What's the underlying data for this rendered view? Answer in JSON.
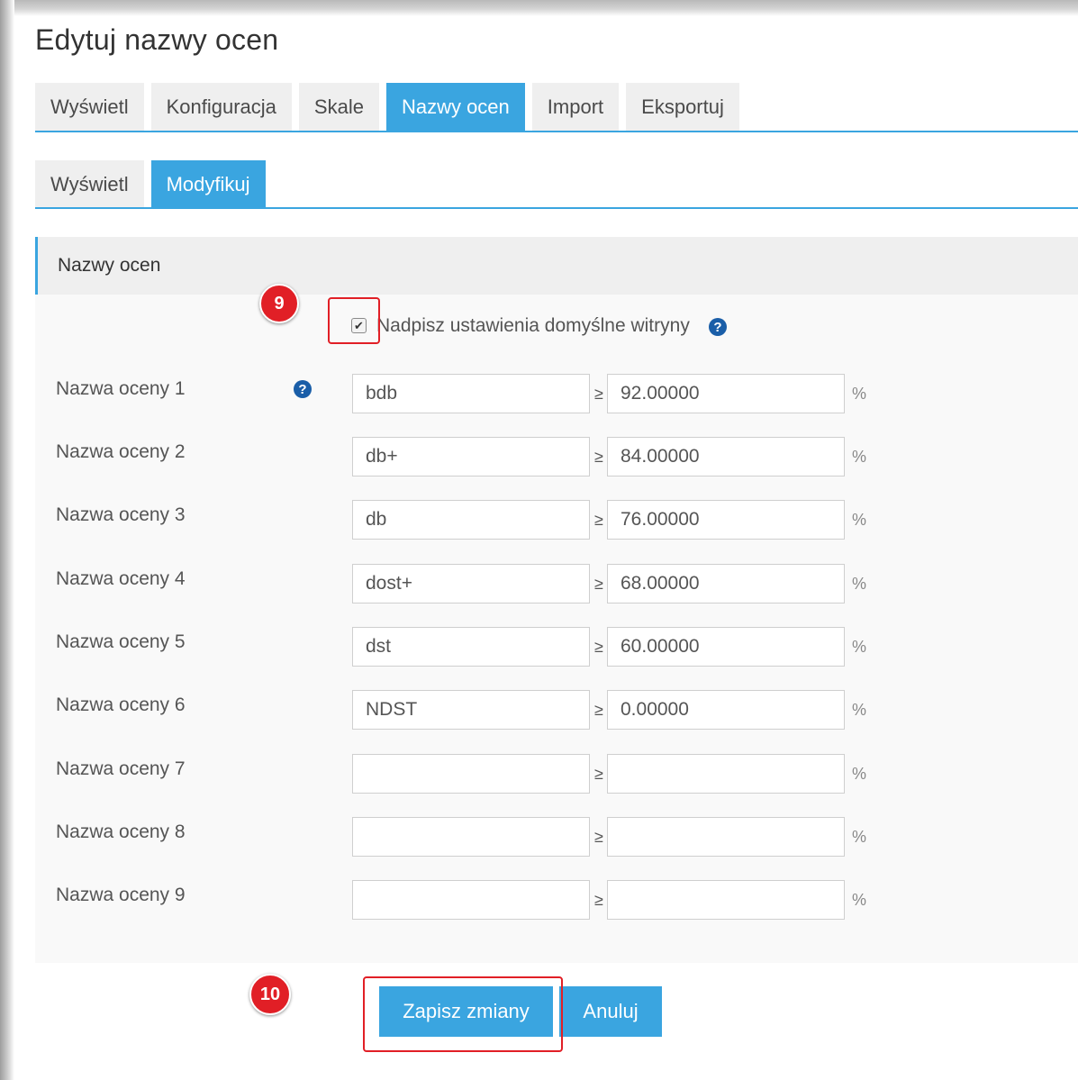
{
  "page": {
    "title": "Edytuj nazwy ocen"
  },
  "tabs_primary": [
    {
      "label": "Wyświetl",
      "active": false
    },
    {
      "label": "Konfiguracja",
      "active": false
    },
    {
      "label": "Skale",
      "active": false
    },
    {
      "label": "Nazwy ocen",
      "active": true
    },
    {
      "label": "Import",
      "active": false
    },
    {
      "label": "Eksportuj",
      "active": false
    }
  ],
  "tabs_secondary": [
    {
      "label": "Wyświetl",
      "active": false
    },
    {
      "label": "Modyfikuj",
      "active": true
    }
  ],
  "section": {
    "title": "Nazwy ocen",
    "override": {
      "label": "Nadpisz ustawienia domyślne witryny",
      "checked": true,
      "check_glyph": "✔",
      "help_glyph": "?"
    }
  },
  "grade_rows": [
    {
      "label": "Nazwa oceny 1",
      "name": "bdb",
      "boundary": "92.00000",
      "ge": "≥",
      "pct": "%",
      "help_glyph": "?"
    },
    {
      "label": "Nazwa oceny 2",
      "name": "db+",
      "boundary": "84.00000",
      "ge": "≥",
      "pct": "%"
    },
    {
      "label": "Nazwa oceny 3",
      "name": "db",
      "boundary": "76.00000",
      "ge": "≥",
      "pct": "%"
    },
    {
      "label": "Nazwa oceny 4",
      "name": "dost+",
      "boundary": "68.00000",
      "ge": "≥",
      "pct": "%"
    },
    {
      "label": "Nazwa oceny 5",
      "name": "dst",
      "boundary": "60.00000",
      "ge": "≥",
      "pct": "%"
    },
    {
      "label": "Nazwa oceny 6",
      "name": "NDST",
      "boundary": "0.00000",
      "ge": "≥",
      "pct": "%"
    },
    {
      "label": "Nazwa oceny 7",
      "name": "",
      "boundary": "",
      "ge": "≥",
      "pct": "%"
    },
    {
      "label": "Nazwa oceny 8",
      "name": "",
      "boundary": "",
      "ge": "≥",
      "pct": "%"
    },
    {
      "label": "Nazwa oceny 9",
      "name": "",
      "boundary": "",
      "ge": "≥",
      "pct": "%"
    }
  ],
  "buttons": {
    "save": "Zapisz zmiany",
    "cancel": "Anuluj"
  },
  "annotations": {
    "step_9": "9",
    "step_10": "10"
  },
  "colors": {
    "accent": "#3aa5e0",
    "help_icon": "#1a5ea8",
    "annotation": "#e11f26"
  },
  "icons": {
    "help": "question-circle-icon",
    "checkbox": "checkbox-checked-icon"
  }
}
